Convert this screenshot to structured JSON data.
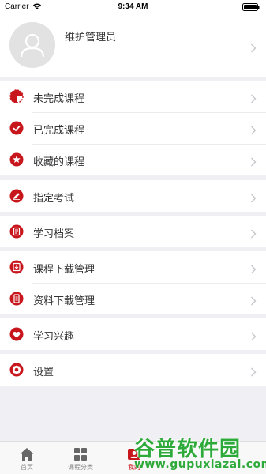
{
  "status_bar": {
    "carrier": "Carrier",
    "time": "9:34 AM"
  },
  "profile": {
    "name": "维护管理员"
  },
  "menu": {
    "incomplete_courses": "未完成课程",
    "completed_courses": "已完成课程",
    "favorite_courses": "收藏的课程",
    "assigned_exams": "指定考试",
    "learning_records": "学习档案",
    "course_download": "课程下载管理",
    "material_download": "资料下载管理",
    "learning_interests": "学习兴趣",
    "settings": "设置"
  },
  "tabbar": {
    "home": "首页",
    "course_category": "课程分类",
    "mine": "我的"
  },
  "watermark": {
    "title": "谷普软件园",
    "url": "www.gupuxlazal.com"
  },
  "colors": {
    "accent": "#c8161d",
    "background": "#efeff4",
    "watermark": "#2eaa3a"
  }
}
